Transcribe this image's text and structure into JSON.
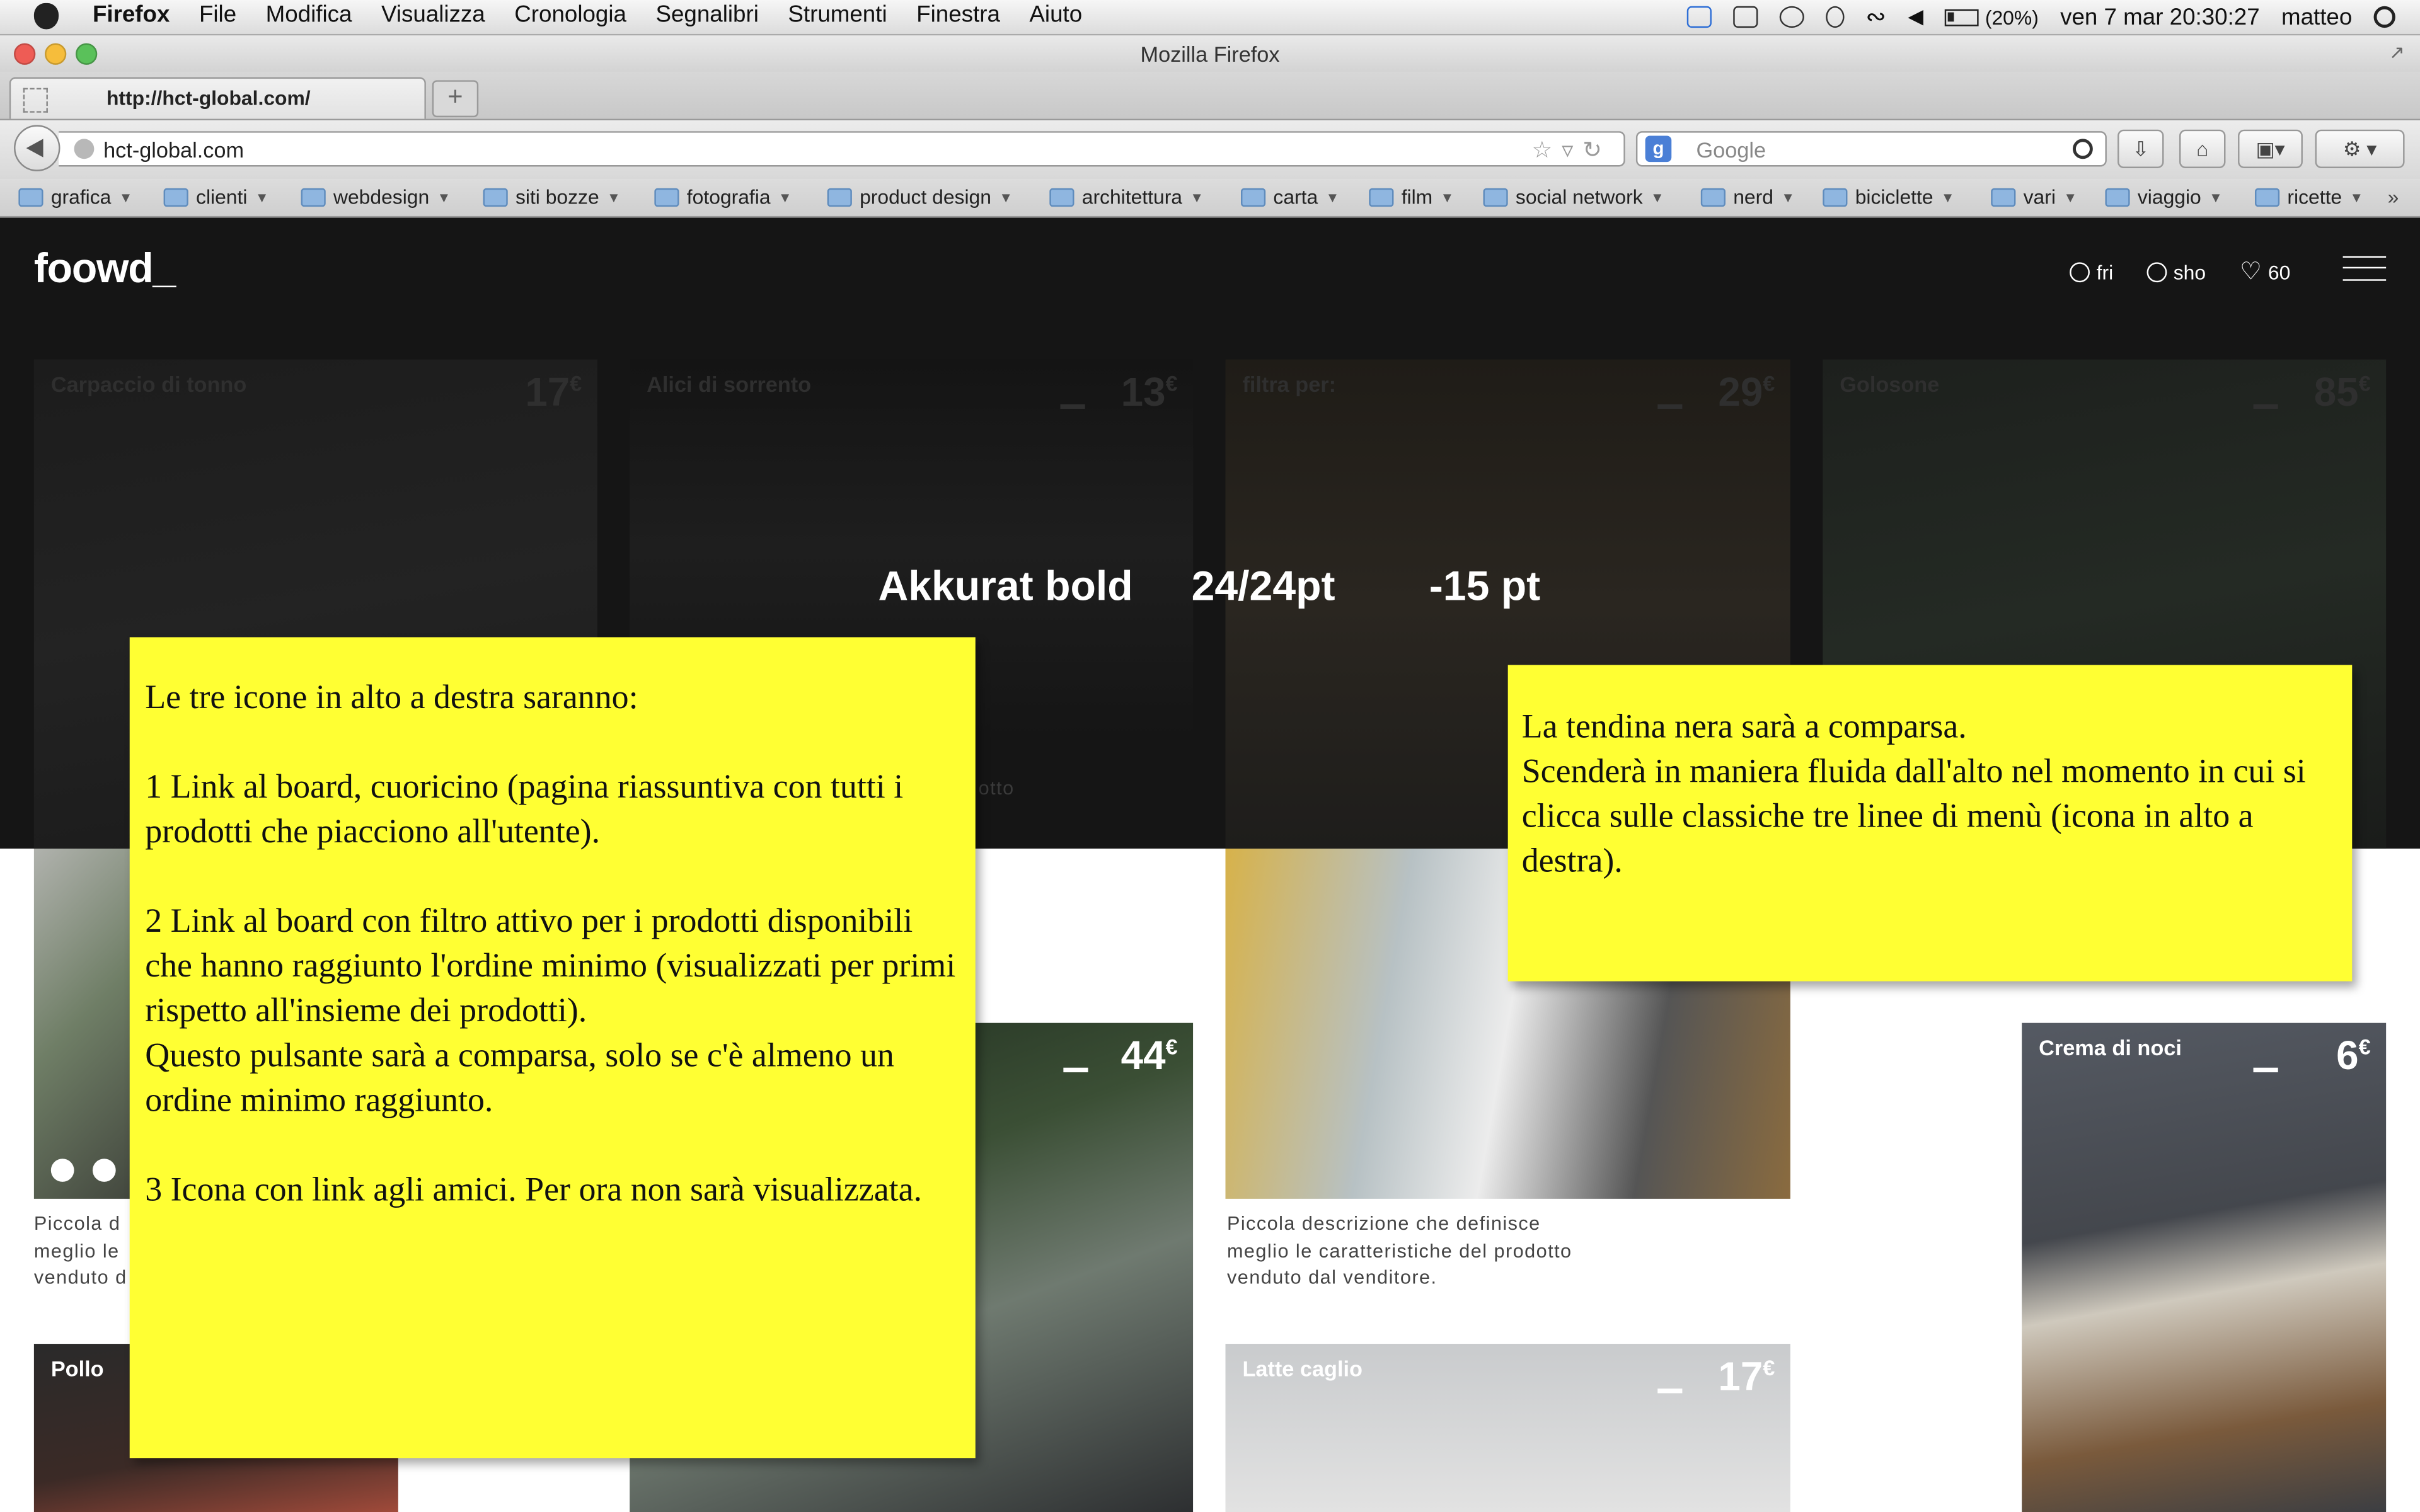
{
  "menubar": {
    "app_name": "Firefox",
    "menus": [
      "File",
      "Modifica",
      "Visualizza",
      "Cronologia",
      "Segnalibri",
      "Strumenti",
      "Finestra",
      "Aiuto"
    ],
    "battery": "(20%)",
    "datetime": "ven 7 mar  20:30:27",
    "user": "matteo"
  },
  "window": {
    "title": "Mozilla Firefox",
    "tab_label": "http://hct-global.com/",
    "new_tab": "+",
    "url": "hct-global.com",
    "search_engine": "Google"
  },
  "bookmarks": [
    "grafica",
    "clienti",
    "webdesign",
    "siti bozze",
    "fotografia",
    "product design",
    "architettura",
    "carta",
    "film",
    "social network",
    "nerd",
    "biciclette",
    "vari",
    "viaggio",
    "ricette"
  ],
  "site": {
    "logo": "foowd_",
    "header_icons": {
      "fri": "fri",
      "sho": "sho",
      "likes": "60"
    },
    "dim_cards": [
      {
        "name": "Carpaccio di tonno",
        "price": "17"
      },
      {
        "name": "Alici di sorrento",
        "price": "13"
      },
      {
        "name": "filtra per:",
        "price": "29"
      },
      {
        "name": "Golosone",
        "price": "85"
      }
    ],
    "dim_fragment": "otto",
    "currency": "€",
    "lit_cards": [
      {
        "name": "",
        "price": "44"
      },
      {
        "name": "Crema di noci",
        "price": "6"
      },
      {
        "name": "Pollo",
        "price": ""
      },
      {
        "name": "Latte caglio",
        "price": "17"
      }
    ],
    "desc_full": [
      "Piccola descrizione che definisce",
      "meglio le caratteristiche del prodotto",
      "venduto dal venditore."
    ],
    "desc_partial": [
      "Piccola d",
      "meglio le",
      "venduto d"
    ]
  },
  "typography": {
    "font": "Akkurat bold",
    "size": "24/24pt",
    "tracking": "-15 pt"
  },
  "note_left": {
    "intro": "Le tre icone in alto a destra saranno:",
    "item1": "1    Link al board, cuoricino (pagina riassuntiva con tutti i prodotti che piacciono all'utente).",
    "item2": "2    Link al board con filtro attivo per i prodotti disponibili che hanno raggiunto l'ordine minimo (visualizzati per primi rispetto all'insieme dei prodotti).",
    "item2b": "Questo pulsante sarà a comparsa, solo se c'è almeno un ordine minimo raggiunto.",
    "item3": "3    Icona con link agli amici. Per ora non sarà visualizzata."
  },
  "note_right": {
    "line1": "La tendina nera sarà a comparsa.",
    "line2": "Scenderà in maniera fluida dall'alto nel momento in cui si clicca sulle classiche tre linee di menù (icona in alto a destra)."
  },
  "colors": {
    "note_yellow": "#ffff33",
    "header_black": "#151515"
  }
}
